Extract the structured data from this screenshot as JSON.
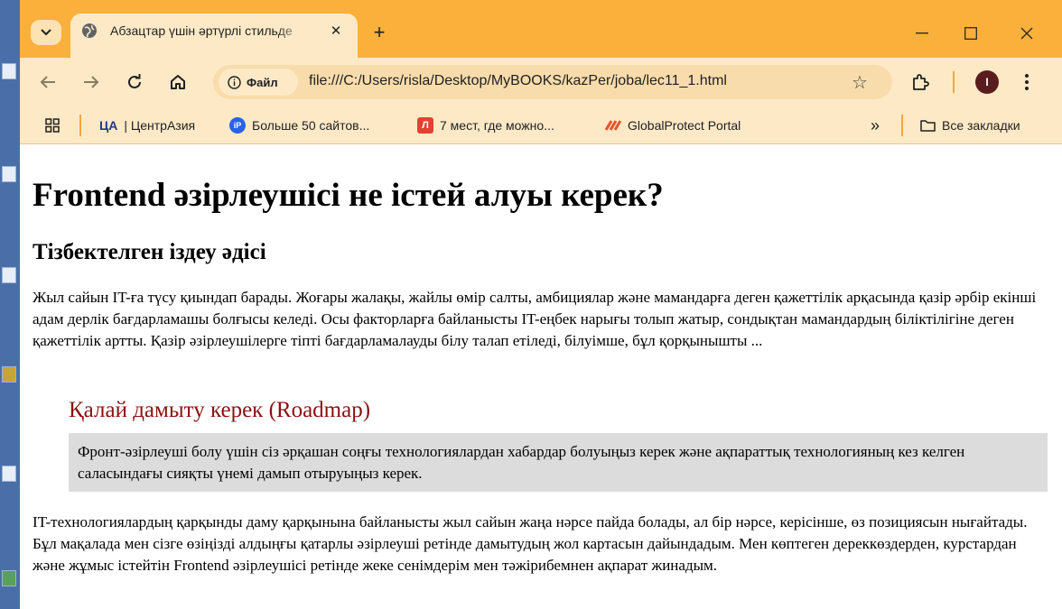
{
  "tab": {
    "title": "Абзацтар үшін әртүрлі стильде"
  },
  "address_bar": {
    "site_label": "Файл",
    "url": "file:///C:/Users/risla/Desktop/MyBOOKS/kazPer/joba/lec11_1.html"
  },
  "profile": {
    "initial": "I"
  },
  "bookmarks": {
    "items": [
      {
        "icon_text": "ЦА",
        "label": "| ЦентрАзия"
      },
      {
        "icon_text": "iP",
        "label": "Больше 50 сайтов..."
      },
      {
        "icon_text": "Л",
        "label": "7 мест, где можно..."
      },
      {
        "icon_text": "",
        "label": "GlobalProtect Portal"
      }
    ],
    "overflow_label": "»",
    "all_bookmarks_label": "Все закладки"
  },
  "page": {
    "h1": "Frontend әзірлеушісі не істей алуы керек?",
    "h2": "Тізбектелген іздеу әдісі",
    "paragraph1": "Жыл сайын IT-ға түсу қиындап барады. Жоғары жалақы, жайлы өмір салты, амбициялар және мамандарға деген қажеттілік арқасында қазір әрбір екінші адам дерлік бағдарламашы болғысы келеді. Осы факторларға байланысты IT-еңбек нарығы толып жатыр, сондықтан мамандардың біліктілігіне деген қажеттілік артты. Қазір әзірлеушілерге тіпті бағдарламалауды білу талап етіледі, білуімше, бұл қорқынышты ...",
    "h3": "Қалай дамыту керек (Roadmap)",
    "note": "Фронт-әзірлеуші болу үшін сіз әрқашан соңғы технологиялардан хабардар болуыңыз керек және ақпараттық технологияның кез келген саласындағы сияқты үнемі дамып отыруыңыз керек.",
    "paragraph2": "IT-технологиялардың қарқынды даму қарқынына байланысты жыл сайын жаңа нәрсе пайда болады, ал бір нәрсе, керісінше, өз позициясын нығайтады. Бұл мақалада мен сізге өзіңізді алдыңғы қатарлы әзірлеуші ретінде дамытудың жол картасын дайындадым. Мен көптеген дереккөздерден, курстардан және жұмыс істейтін Frontend әзірлеушісі ретінде жеке сенімдерім мен тәжірибемнен ақпарат жинадым."
  },
  "colors": {
    "title_bar": "#fbb03b",
    "toolbar": "#fde9c6",
    "h3_text": "#8b1010",
    "note_background": "#dcdcdc"
  },
  "icons": [
    "tab-search-icon",
    "globe-icon",
    "close-icon",
    "plus-icon",
    "minimize-icon",
    "maximize-icon",
    "window-close-icon",
    "back-arrow-icon",
    "forward-arrow-icon",
    "reload-icon",
    "home-icon",
    "info-icon",
    "star-icon",
    "extensions-icon",
    "kebab-menu-icon",
    "apps-grid-icon",
    "folder-icon"
  ]
}
